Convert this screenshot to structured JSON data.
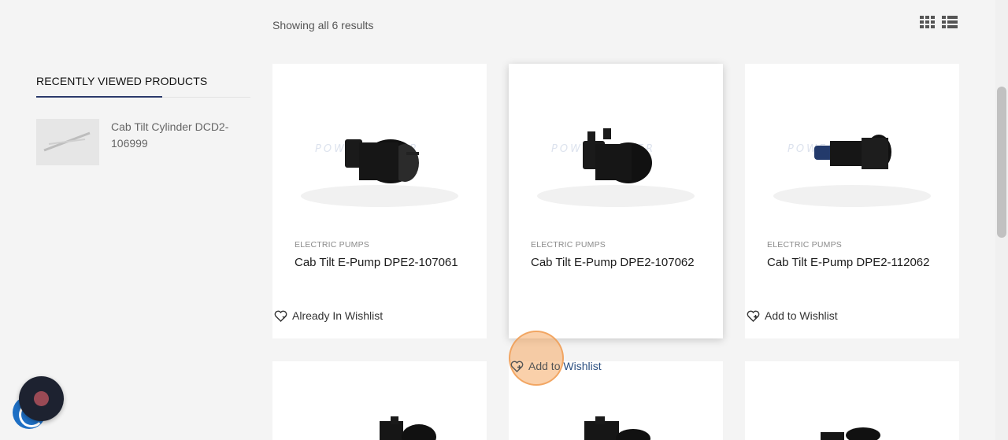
{
  "results": {
    "text": "Showing all 6 results"
  },
  "view_toggle": {
    "grid_icon": "grid-view-icon",
    "list_icon": "list-view-icon"
  },
  "sidebar": {
    "title": "RECENTLY VIEWED PRODUCTS",
    "items": [
      {
        "name": "Cab Tilt Cylinder DCD2-106999"
      }
    ]
  },
  "products": [
    {
      "category": "ELECTRIC PUMPS",
      "title": "Cab Tilt E-Pump DPE2-107061",
      "wishlist": "Already In Wishlist"
    },
    {
      "category": "ELECTRIC PUMPS",
      "title": "Cab Tilt E-Pump DPE2-107062",
      "wishlist": "Add to Wishlist"
    },
    {
      "category": "ELECTRIC PUMPS",
      "title": "Cab Tilt E-Pump DPE2-112062",
      "wishlist": "Add to Wishlist"
    }
  ],
  "hover_wishlist": {
    "part1": "Add to ",
    "part2": "Wishlist"
  },
  "colors": {
    "accent": "#2b3a6b",
    "link": "#2b4f80",
    "fab": "#1d2230",
    "fab_dot": "#9a4a55",
    "click_marker": "#f6aa64"
  }
}
